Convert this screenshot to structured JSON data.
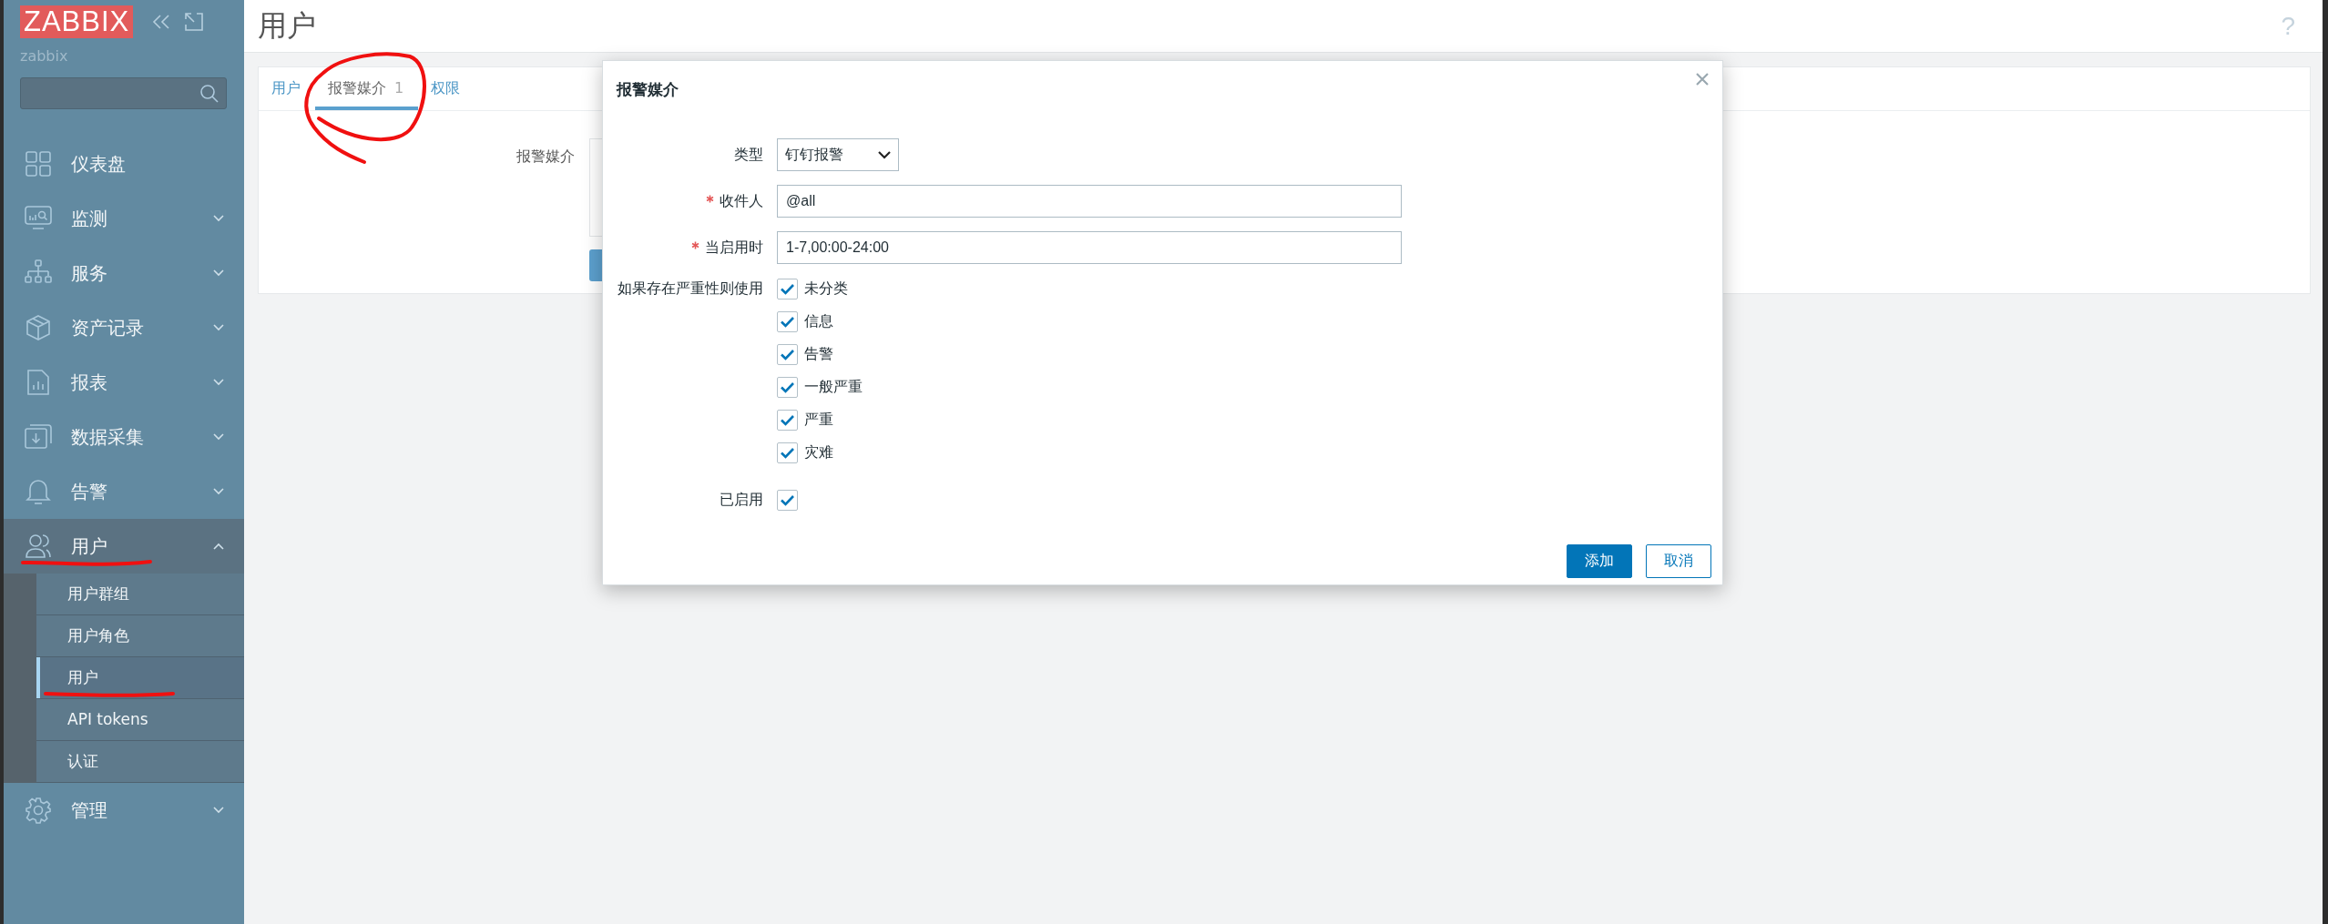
{
  "sidebar": {
    "logo": "ZABBIX",
    "server": "zabbix",
    "items": [
      {
        "label": "仪表盘",
        "kind": "link",
        "selected": false
      },
      {
        "label": "监测",
        "kind": "group",
        "expanded": false,
        "selected": false
      },
      {
        "label": "服务",
        "kind": "group",
        "expanded": false,
        "selected": false
      },
      {
        "label": "资产记录",
        "kind": "group",
        "expanded": false,
        "selected": false
      },
      {
        "label": "报表",
        "kind": "group",
        "expanded": false,
        "selected": false
      },
      {
        "label": "数据采集",
        "kind": "group",
        "expanded": false,
        "selected": false
      },
      {
        "label": "告警",
        "kind": "group",
        "expanded": false,
        "selected": false
      },
      {
        "label": "用户",
        "kind": "group",
        "expanded": true,
        "selected": true,
        "children": [
          {
            "label": "用户群组",
            "selected": false
          },
          {
            "label": "用户角色",
            "selected": false
          },
          {
            "label": "用户",
            "selected": true
          },
          {
            "label": "API tokens",
            "selected": false
          },
          {
            "label": "认证",
            "selected": false
          }
        ]
      },
      {
        "label": "管理",
        "kind": "group",
        "expanded": false,
        "selected": false
      }
    ]
  },
  "header": {
    "title": "用户",
    "help": "?"
  },
  "tabs": [
    {
      "label": "用户",
      "selected": false
    },
    {
      "label": "报警媒介",
      "count": "1",
      "selected": true
    },
    {
      "label": "权限",
      "selected": false
    }
  ],
  "form": {
    "label": "报警媒介"
  },
  "dialog": {
    "title": "报警媒介",
    "fields": [
      {
        "kind": "select",
        "label": "类型",
        "required": false,
        "value": "钉钉报警"
      },
      {
        "kind": "text",
        "label": "收件人",
        "required": true,
        "value": "@all"
      },
      {
        "kind": "text",
        "label": "当启用时",
        "required": true,
        "value": "1-7,00:00-24:00"
      },
      {
        "kind": "checkgroup",
        "label": "如果存在严重性则使用",
        "options": [
          {
            "label": "未分类",
            "checked": true
          },
          {
            "label": "信息",
            "checked": true
          },
          {
            "label": "告警",
            "checked": true
          },
          {
            "label": "一般严重",
            "checked": true
          },
          {
            "label": "严重",
            "checked": true
          },
          {
            "label": "灾难",
            "checked": true
          }
        ]
      },
      {
        "kind": "checkbox",
        "label": "已启用",
        "checked": true
      }
    ],
    "buttons": [
      {
        "label": "添加",
        "primary": true
      },
      {
        "label": "取消",
        "primary": false
      }
    ]
  }
}
